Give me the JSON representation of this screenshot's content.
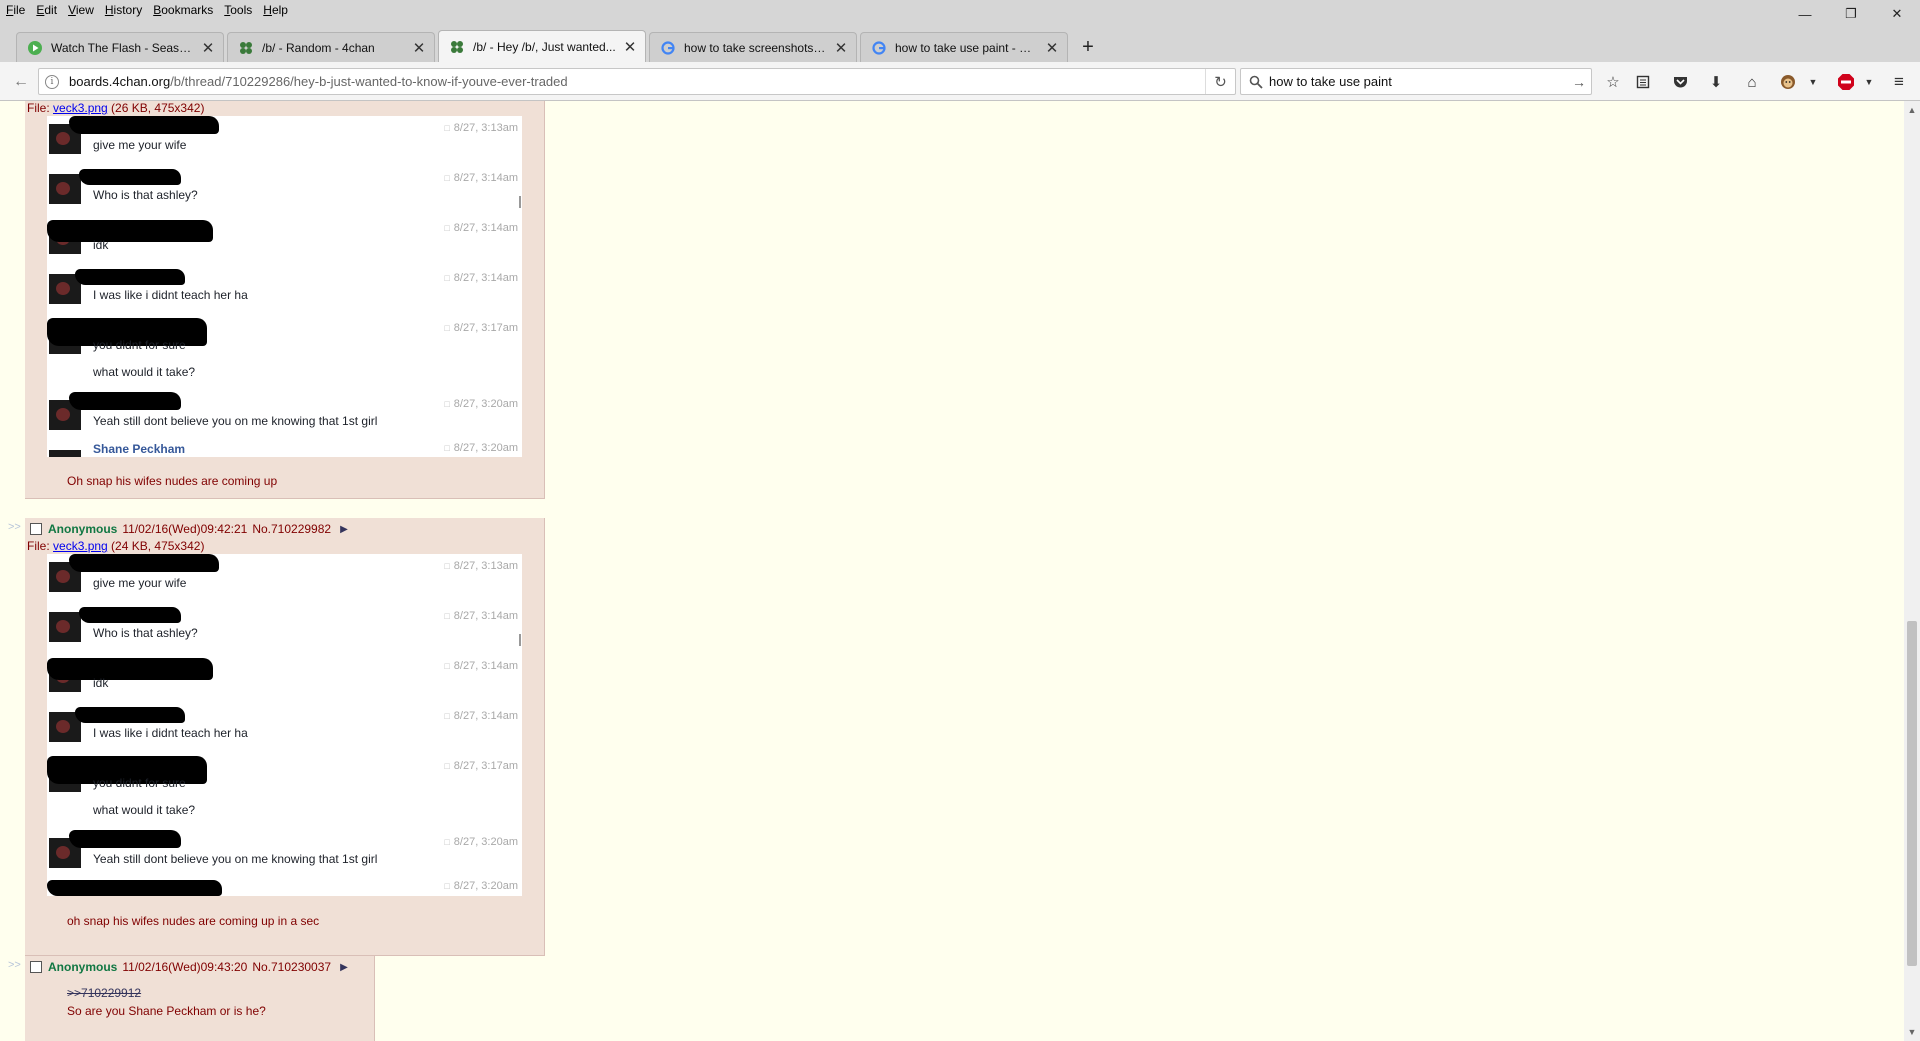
{
  "browser": {
    "menu": [
      "File",
      "Edit",
      "View",
      "History",
      "Bookmarks",
      "Tools",
      "Help"
    ],
    "tabs": [
      {
        "title": "Watch The Flash - Season ...",
        "icon": "play-icon"
      },
      {
        "title": "/b/ - Random - 4chan",
        "icon": "clover-icon"
      },
      {
        "title": "/b/ - Hey /b/, Just wanted...",
        "icon": "clover-icon"
      },
      {
        "title": "how to take screenshots - ...",
        "icon": "google-icon"
      },
      {
        "title": "how to take use paint - Go...",
        "icon": "google-icon"
      }
    ],
    "url_host": "boards.4chan.org",
    "url_path": "/b/thread/710229286/hey-b-just-wanted-to-know-if-youve-ever-traded",
    "search_value": "how to take use paint"
  },
  "chat": {
    "messages": [
      {
        "time": "8/27, 3:13am",
        "text": "give me your wife"
      },
      {
        "time": "8/27, 3:14am",
        "text": "Who is that ashley?"
      },
      {
        "time": "8/27, 3:14am",
        "text": "idk"
      },
      {
        "time": "8/27, 3:14am",
        "text": "I was like i didnt teach her ha"
      },
      {
        "time": "8/27, 3:17am",
        "text": "you didnt for sure",
        "text2": "what would it take?"
      },
      {
        "time": "8/27, 3:20am",
        "text": "Yeah still dont believe you on me knowing that 1st girl"
      }
    ],
    "partial_name": "Shane Peckham",
    "partial_time": "8/27, 3:20am"
  },
  "posts": [
    {
      "file_label": "File: ",
      "file_name": "veck3.png",
      "file_meta": " (26 KB, 475x342)",
      "message": "Oh snap his wifes nudes are coming up"
    },
    {
      "side": ">>",
      "name": "Anonymous",
      "date": "11/02/16(Wed)09:42:21",
      "no": "No.710229982",
      "menu": "▶",
      "file_label": "File: ",
      "file_name": "veck3.png",
      "file_meta": " (24 KB, 475x342)",
      "message": "oh snap his wifes nudes are coming up in a sec"
    },
    {
      "side": ">>",
      "name": "Anonymous",
      "date": "11/02/16(Wed)09:43:20",
      "no": "No.710230037",
      "menu": "▶",
      "quote": ">>710229912",
      "message": "So are you Shane Peckham or is he?"
    }
  ]
}
